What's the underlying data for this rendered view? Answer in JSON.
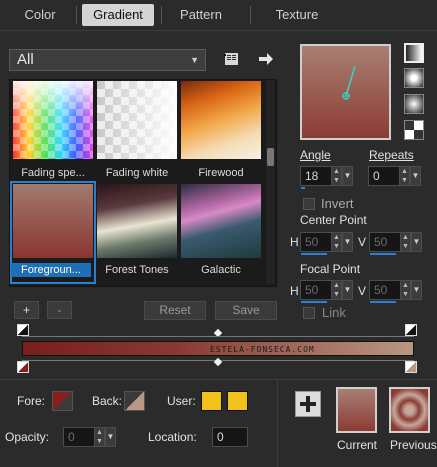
{
  "tabs": [
    {
      "label": "Color"
    },
    {
      "label": "Gradient"
    },
    {
      "label": "Pattern"
    },
    {
      "label": "Texture"
    }
  ],
  "active_tab": "Gradient",
  "category_dropdown": {
    "value": "All"
  },
  "gallery": {
    "items": [
      {
        "label": "Fading spe..."
      },
      {
        "label": "Fading white"
      },
      {
        "label": "Firewood"
      },
      {
        "label": "Foregroun...",
        "selected": true
      },
      {
        "label": "Forest Tones"
      },
      {
        "label": "Galactic"
      }
    ]
  },
  "toolbar": {
    "add_label": "+",
    "remove_label": "-",
    "reset_label": "Reset",
    "save_label": "Save"
  },
  "angle": {
    "label": "Angle",
    "value": "18"
  },
  "repeats": {
    "label": "Repeats",
    "value": "0"
  },
  "invert": {
    "label": "Invert"
  },
  "center_point": {
    "label": "Center Point",
    "h_label": "H",
    "h_value": "50",
    "v_label": "V",
    "v_value": "50"
  },
  "focal_point": {
    "label": "Focal Point",
    "h_label": "H",
    "h_value": "50",
    "v_label": "V",
    "v_value": "50"
  },
  "link": {
    "label": "Link"
  },
  "gradient_bar": {
    "watermark": "ESTELA-FONSECA.COM"
  },
  "bottom": {
    "fore_label": "Fore:",
    "back_label": "Back:",
    "user_label": "User:",
    "opacity_label": "Opacity:",
    "opacity_value": "0",
    "location_label": "Location:",
    "location_value": "0",
    "current_label": "Current",
    "previous_label": "Previous"
  },
  "colors": {
    "accent": "#2d7fd3",
    "fore": "#8b1f1c",
    "user": "#f2c21c",
    "gradient_start": "#7a1e1b",
    "gradient_end": "#b99783"
  }
}
